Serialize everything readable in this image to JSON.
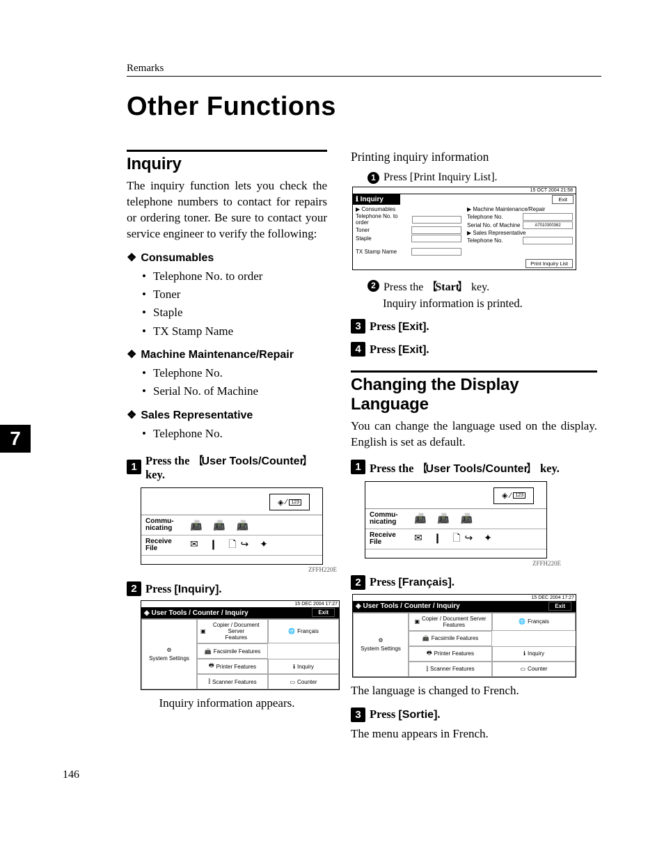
{
  "running_head": "Remarks",
  "title": "Other Functions",
  "page_number": "146",
  "chapter_tab": "7",
  "fig_caption": "ZFFH220E",
  "left": {
    "h_inquiry": "Inquiry",
    "p_inquiry": "The inquiry function lets you check the telephone numbers to contact for repairs or ordering toner. Be sure to contact your service engineer to verify the following:",
    "h_consumables": "Consumables",
    "consumables": [
      "Telephone No. to order",
      "Toner",
      "Staple",
      "TX Stamp Name"
    ],
    "h_maint": "Machine Maintenance/Repair",
    "maint": [
      "Telephone No.",
      "Serial No. of Machine"
    ],
    "h_sales": "Sales Representative",
    "sales": [
      "Telephone No."
    ],
    "step1_a": "Press the",
    "step1_key": "User Tools/Counter",
    "step1_b": "key.",
    "step2_a": "Press",
    "step2_btn": "[Inquiry]",
    "step2_dot": ".",
    "after_step2": "Inquiry information appears.",
    "lcd": {
      "row1": "Commu-\nnicating",
      "row2": "Receive\nFile",
      "top_btn_glyph": "◈⁄▭"
    },
    "utools": {
      "titlebar": "◈ User Tools / Counter / Inquiry",
      "datetime": "15 DEC 2004 17:27",
      "exit": "Exit",
      "system": "System Settings",
      "copier": "Copier / Document Server\nFeatures",
      "francais": "Français",
      "fax": "Facsimile Features",
      "printer": "Printer Features",
      "inquiry": "Inquiry",
      "scanner": "Scanner Features",
      "counter": "Counter"
    }
  },
  "right": {
    "sub_heading": "Printing inquiry information",
    "sub1_a": "Press",
    "sub1_btn": "[Print Inquiry List]",
    "sub1_dot": ".",
    "sub2_a": "Press the",
    "sub2_key": "Start",
    "sub2_b": "key.",
    "sub2_body": "Inquiry information is printed.",
    "step3_a": "Press",
    "step3_btn": "[Exit]",
    "step3_dot": ".",
    "step4_a": "Press",
    "step4_btn": "[Exit]",
    "step4_dot": ".",
    "h_lang": "Changing the Display Language",
    "p_lang": "You can change the language used on the display. English is set as default.",
    "lstep1_a": "Press the",
    "lstep1_key": "User Tools/Counter",
    "lstep1_b": "key.",
    "lstep2_a": "Press",
    "lstep2_btn": "[Français]",
    "lstep2_dot": ".",
    "after_l2": "The language is changed to French.",
    "lstep3_a": "Press",
    "lstep3_btn": "[Sortie]",
    "lstep3_dot": ".",
    "after_l3": "The menu appears in French.",
    "inquiry_fig": {
      "datetime": "15 OCT 2004 21:58",
      "exit": "Exit",
      "bar": "ℹ  Inquiry",
      "l_head": "▶ Consumables",
      "l1": "Telephone No. to order",
      "l2": "Toner",
      "l3": "Staple",
      "l4": "TX Stamp Name",
      "r_head": "▶ Machine Maintenance/Repair",
      "r1": "Telephone No.",
      "r2": "Serial No. of Machine",
      "r2v": "A7010300362",
      "r_head2": "▶ Sales Representative",
      "r3": "Telephone No.",
      "btn": "Print Inquiry List"
    }
  }
}
